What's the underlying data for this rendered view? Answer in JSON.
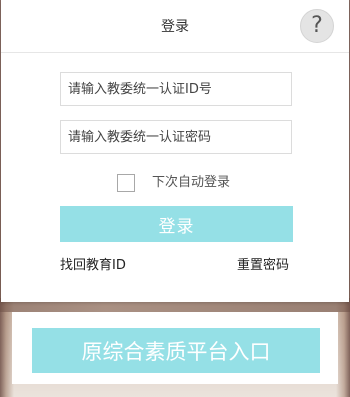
{
  "dialog": {
    "title": "登录",
    "help_icon": "question-mark-icon",
    "help_glyph": "?"
  },
  "form": {
    "id_placeholder": "请输入教委统一认证ID号",
    "password_placeholder": "请输入教委统一认证密码",
    "remember_label": "下次自动登录",
    "remember_checked": false,
    "login_label": "登录"
  },
  "links": {
    "recover_id": "找回教育ID",
    "reset_password": "重置密码"
  },
  "legacy": {
    "entry_label": "原综合素质平台入口"
  },
  "colors": {
    "accent": "#95e0e6",
    "accent_text": "#ffffff",
    "header_border": "#e6e6e6",
    "text": "#333333"
  }
}
